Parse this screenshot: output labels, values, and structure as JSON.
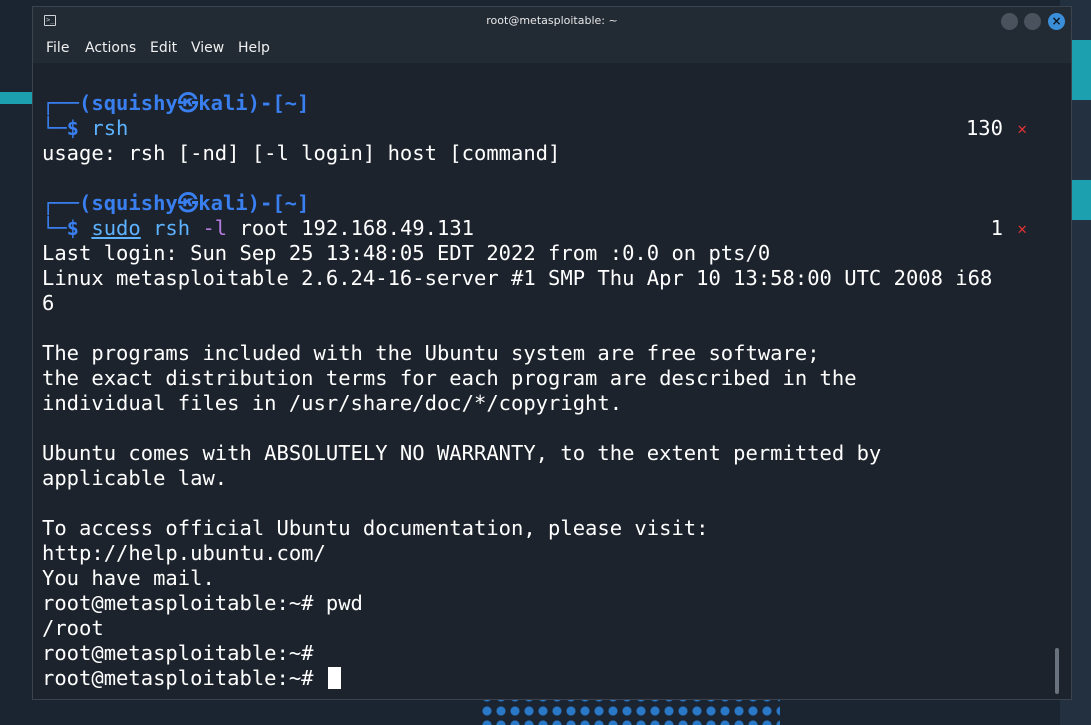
{
  "window": {
    "title": "root@metasploitable: ~"
  },
  "menu": [
    "File",
    "Actions",
    "Edit",
    "View",
    "Help"
  ],
  "prompt1": {
    "user_part": "┌──(squishy㉿kali)-[~]",
    "cmd_prefix": "└─$ ",
    "cmd": "rsh",
    "exit_code": "130",
    "status_icon": "✕"
  },
  "usage_line": "usage: rsh [-nd] [-l login] host [command]",
  "prompt2": {
    "user_part": "┌──(squishy㉿kali)-[~]",
    "cmd_prefix": "└─$ ",
    "sudo": "sudo",
    "rsh": "rsh",
    "flag": "-l",
    "args": "root 192.168.49.131",
    "exit_code": "1",
    "status_icon": "✕"
  },
  "output": [
    "Last login: Sun Sep 25 13:48:05 EDT 2022 from :0.0 on pts/0",
    "Linux metasploitable 2.6.24-16-server #1 SMP Thu Apr 10 13:58:00 UTC 2008 i68",
    "6",
    "",
    "The programs included with the Ubuntu system are free software;",
    "the exact distribution terms for each program are described in the",
    "individual files in /usr/share/doc/*/copyright.",
    "",
    "Ubuntu comes with ABSOLUTELY NO WARRANTY, to the extent permitted by",
    "applicable law.",
    "",
    "To access official Ubuntu documentation, please visit:",
    "http://help.ubuntu.com/",
    "You have mail.",
    "root@metasploitable:~# pwd",
    "/root",
    "root@metasploitable:~#",
    "root@metasploitable:~# "
  ],
  "colors": {
    "prompt_blue": "#3a7ff0",
    "command_blue": "#5db3ff",
    "error_red": "#e03333",
    "option_purple": "#b57cdf"
  }
}
